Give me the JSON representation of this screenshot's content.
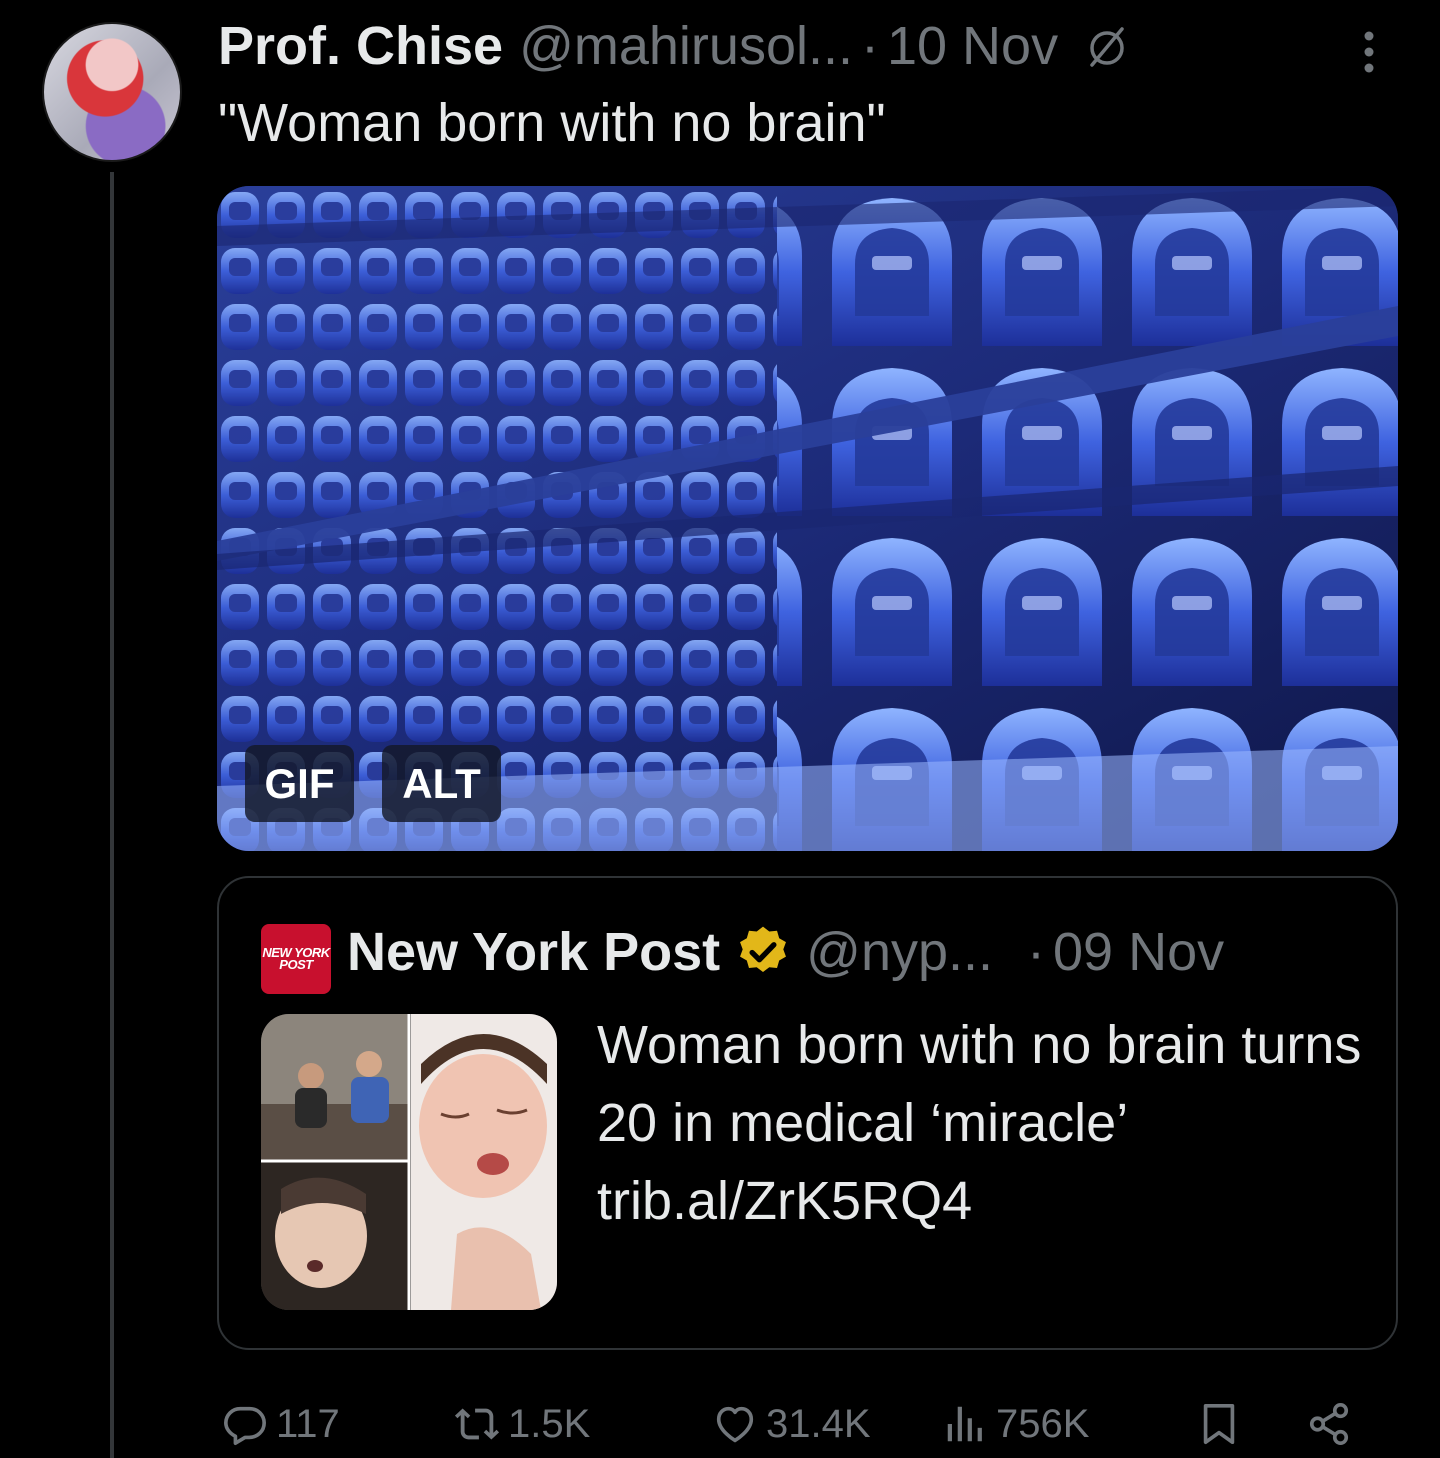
{
  "tweet": {
    "author_name": "Prof. Chise",
    "handle": "@mahirusol...",
    "separator": "·",
    "date": "10 Nov",
    "text": "\"Woman born with no brain\"",
    "media": {
      "gif_badge": "GIF",
      "alt_badge": "ALT"
    }
  },
  "quote": {
    "logo_text": "NEW YORK POST",
    "author_name": "New York Post",
    "handle": "@nyp...",
    "separator": "·",
    "date": "09 Nov",
    "text": "Woman born with no brain turns 20 in medical ‘miracle’ trib.al/ZrK5RQ4"
  },
  "actions": {
    "replies": "117",
    "reposts": "1.5K",
    "likes": "31.4K",
    "views": "756K"
  },
  "colors": {
    "background": "#000000",
    "text": "#e7e9ea",
    "muted": "#71767b",
    "border": "#2f3336",
    "verified_gold": "#e2b719",
    "nyp_red": "#c8102e"
  },
  "icons": [
    "slash-icon",
    "more-icon",
    "verified-icon",
    "reply-icon",
    "repost-icon",
    "like-icon",
    "views-icon",
    "bookmark-icon",
    "share-icon"
  ]
}
